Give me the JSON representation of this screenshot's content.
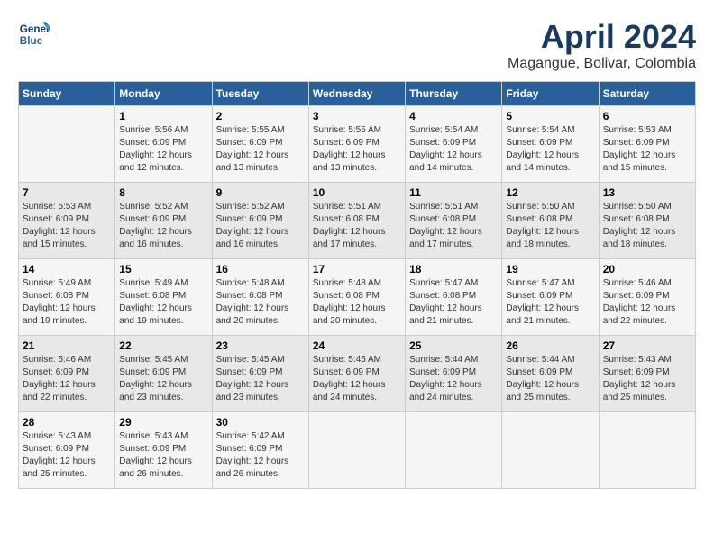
{
  "header": {
    "logo_line1": "General",
    "logo_line2": "Blue",
    "month_year": "April 2024",
    "location": "Magangue, Bolivar, Colombia"
  },
  "weekdays": [
    "Sunday",
    "Monday",
    "Tuesday",
    "Wednesday",
    "Thursday",
    "Friday",
    "Saturday"
  ],
  "weeks": [
    [
      {
        "day": "",
        "sunrise": "",
        "sunset": "",
        "daylight": ""
      },
      {
        "day": "1",
        "sunrise": "Sunrise: 5:56 AM",
        "sunset": "Sunset: 6:09 PM",
        "daylight": "Daylight: 12 hours and 12 minutes."
      },
      {
        "day": "2",
        "sunrise": "Sunrise: 5:55 AM",
        "sunset": "Sunset: 6:09 PM",
        "daylight": "Daylight: 12 hours and 13 minutes."
      },
      {
        "day": "3",
        "sunrise": "Sunrise: 5:55 AM",
        "sunset": "Sunset: 6:09 PM",
        "daylight": "Daylight: 12 hours and 13 minutes."
      },
      {
        "day": "4",
        "sunrise": "Sunrise: 5:54 AM",
        "sunset": "Sunset: 6:09 PM",
        "daylight": "Daylight: 12 hours and 14 minutes."
      },
      {
        "day": "5",
        "sunrise": "Sunrise: 5:54 AM",
        "sunset": "Sunset: 6:09 PM",
        "daylight": "Daylight: 12 hours and 14 minutes."
      },
      {
        "day": "6",
        "sunrise": "Sunrise: 5:53 AM",
        "sunset": "Sunset: 6:09 PM",
        "daylight": "Daylight: 12 hours and 15 minutes."
      }
    ],
    [
      {
        "day": "7",
        "sunrise": "Sunrise: 5:53 AM",
        "sunset": "Sunset: 6:09 PM",
        "daylight": "Daylight: 12 hours and 15 minutes."
      },
      {
        "day": "8",
        "sunrise": "Sunrise: 5:52 AM",
        "sunset": "Sunset: 6:09 PM",
        "daylight": "Daylight: 12 hours and 16 minutes."
      },
      {
        "day": "9",
        "sunrise": "Sunrise: 5:52 AM",
        "sunset": "Sunset: 6:09 PM",
        "daylight": "Daylight: 12 hours and 16 minutes."
      },
      {
        "day": "10",
        "sunrise": "Sunrise: 5:51 AM",
        "sunset": "Sunset: 6:08 PM",
        "daylight": "Daylight: 12 hours and 17 minutes."
      },
      {
        "day": "11",
        "sunrise": "Sunrise: 5:51 AM",
        "sunset": "Sunset: 6:08 PM",
        "daylight": "Daylight: 12 hours and 17 minutes."
      },
      {
        "day": "12",
        "sunrise": "Sunrise: 5:50 AM",
        "sunset": "Sunset: 6:08 PM",
        "daylight": "Daylight: 12 hours and 18 minutes."
      },
      {
        "day": "13",
        "sunrise": "Sunrise: 5:50 AM",
        "sunset": "Sunset: 6:08 PM",
        "daylight": "Daylight: 12 hours and 18 minutes."
      }
    ],
    [
      {
        "day": "14",
        "sunrise": "Sunrise: 5:49 AM",
        "sunset": "Sunset: 6:08 PM",
        "daylight": "Daylight: 12 hours and 19 minutes."
      },
      {
        "day": "15",
        "sunrise": "Sunrise: 5:49 AM",
        "sunset": "Sunset: 6:08 PM",
        "daylight": "Daylight: 12 hours and 19 minutes."
      },
      {
        "day": "16",
        "sunrise": "Sunrise: 5:48 AM",
        "sunset": "Sunset: 6:08 PM",
        "daylight": "Daylight: 12 hours and 20 minutes."
      },
      {
        "day": "17",
        "sunrise": "Sunrise: 5:48 AM",
        "sunset": "Sunset: 6:08 PM",
        "daylight": "Daylight: 12 hours and 20 minutes."
      },
      {
        "day": "18",
        "sunrise": "Sunrise: 5:47 AM",
        "sunset": "Sunset: 6:08 PM",
        "daylight": "Daylight: 12 hours and 21 minutes."
      },
      {
        "day": "19",
        "sunrise": "Sunrise: 5:47 AM",
        "sunset": "Sunset: 6:09 PM",
        "daylight": "Daylight: 12 hours and 21 minutes."
      },
      {
        "day": "20",
        "sunrise": "Sunrise: 5:46 AM",
        "sunset": "Sunset: 6:09 PM",
        "daylight": "Daylight: 12 hours and 22 minutes."
      }
    ],
    [
      {
        "day": "21",
        "sunrise": "Sunrise: 5:46 AM",
        "sunset": "Sunset: 6:09 PM",
        "daylight": "Daylight: 12 hours and 22 minutes."
      },
      {
        "day": "22",
        "sunrise": "Sunrise: 5:45 AM",
        "sunset": "Sunset: 6:09 PM",
        "daylight": "Daylight: 12 hours and 23 minutes."
      },
      {
        "day": "23",
        "sunrise": "Sunrise: 5:45 AM",
        "sunset": "Sunset: 6:09 PM",
        "daylight": "Daylight: 12 hours and 23 minutes."
      },
      {
        "day": "24",
        "sunrise": "Sunrise: 5:45 AM",
        "sunset": "Sunset: 6:09 PM",
        "daylight": "Daylight: 12 hours and 24 minutes."
      },
      {
        "day": "25",
        "sunrise": "Sunrise: 5:44 AM",
        "sunset": "Sunset: 6:09 PM",
        "daylight": "Daylight: 12 hours and 24 minutes."
      },
      {
        "day": "26",
        "sunrise": "Sunrise: 5:44 AM",
        "sunset": "Sunset: 6:09 PM",
        "daylight": "Daylight: 12 hours and 25 minutes."
      },
      {
        "day": "27",
        "sunrise": "Sunrise: 5:43 AM",
        "sunset": "Sunset: 6:09 PM",
        "daylight": "Daylight: 12 hours and 25 minutes."
      }
    ],
    [
      {
        "day": "28",
        "sunrise": "Sunrise: 5:43 AM",
        "sunset": "Sunset: 6:09 PM",
        "daylight": "Daylight: 12 hours and 25 minutes."
      },
      {
        "day": "29",
        "sunrise": "Sunrise: 5:43 AM",
        "sunset": "Sunset: 6:09 PM",
        "daylight": "Daylight: 12 hours and 26 minutes."
      },
      {
        "day": "30",
        "sunrise": "Sunrise: 5:42 AM",
        "sunset": "Sunset: 6:09 PM",
        "daylight": "Daylight: 12 hours and 26 minutes."
      },
      {
        "day": "",
        "sunrise": "",
        "sunset": "",
        "daylight": ""
      },
      {
        "day": "",
        "sunrise": "",
        "sunset": "",
        "daylight": ""
      },
      {
        "day": "",
        "sunrise": "",
        "sunset": "",
        "daylight": ""
      },
      {
        "day": "",
        "sunrise": "",
        "sunset": "",
        "daylight": ""
      }
    ]
  ]
}
